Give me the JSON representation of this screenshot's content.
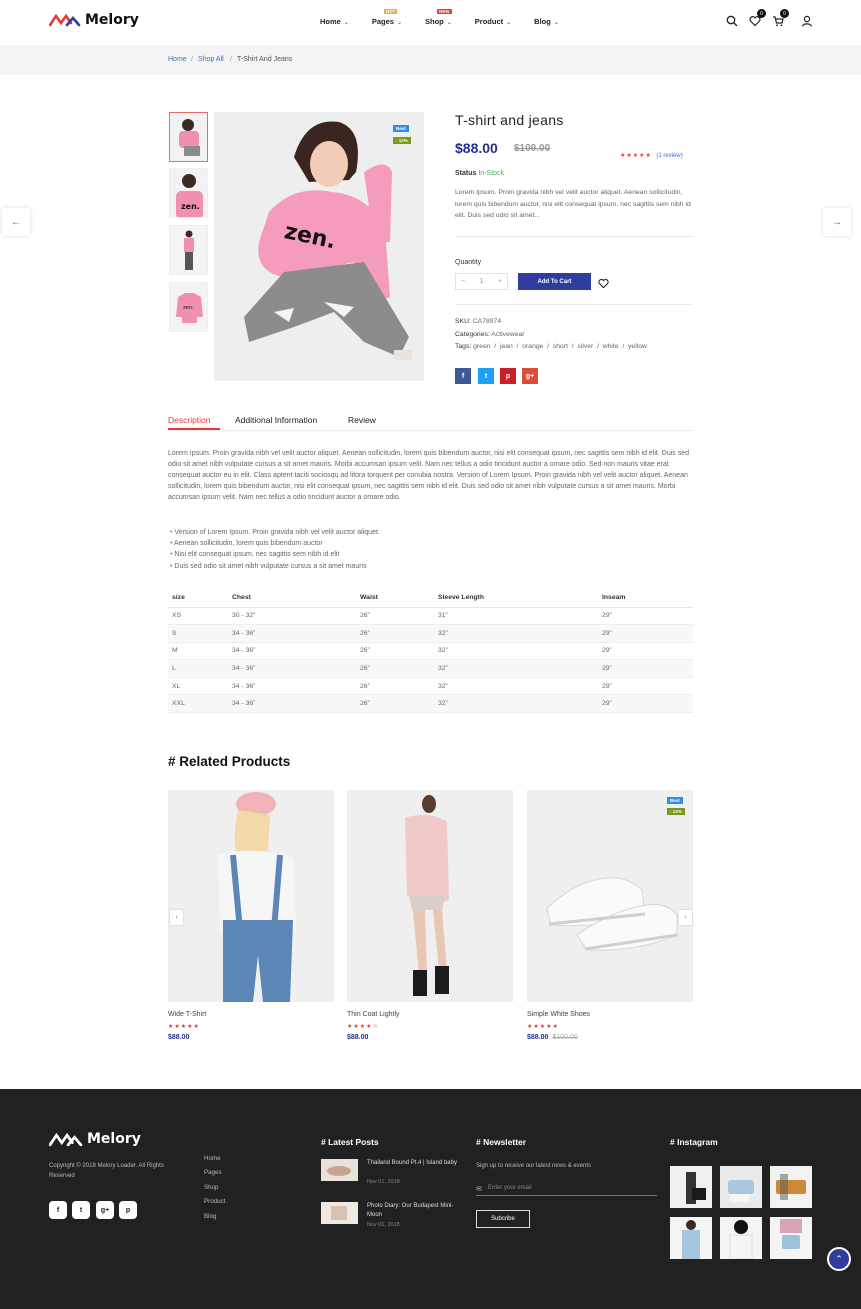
{
  "header": {
    "logo": "Melory",
    "nav": [
      {
        "label": "Home",
        "badge": ""
      },
      {
        "label": "Pages",
        "badge": "HOT",
        "badge_color": "#f0a34c"
      },
      {
        "label": "Shop",
        "badge": "NEW",
        "badge_color": "#e53935"
      },
      {
        "label": "Product",
        "badge": ""
      },
      {
        "label": "Blog",
        "badge": ""
      }
    ],
    "wishlist_count": "0",
    "cart_count": "0"
  },
  "breadcrumb": {
    "home": "Home",
    "shop": "Shop All",
    "sep": "/",
    "current": "T-Shirt And Jeans"
  },
  "product": {
    "title": "T-shirt and jeans",
    "price": "$88.00",
    "old_price": "$100.00",
    "stars": "★★★★★",
    "review_link": "(1 review)",
    "status_label": "Status",
    "status_value": "In-Stock",
    "excerpt": "Lorem Ipsum. Proin gravida nibh vel velit auctor aliquet. Aenean sollicitudin, lorem quis bibendum auctor, nisi elit consequat ipsum, nec sagittis sem nibh id elit. Duis sed odio sit amet...",
    "quantity_label": "Quantity",
    "quantity_value": "1",
    "qty_minus": "−",
    "qty_plus": "+",
    "add_to_cart": "Add To Cart",
    "badge_best": "Best",
    "badge_discount": "- 12%",
    "sku_label": "SKU:",
    "sku": "CA78974",
    "categories_label": "Categories:",
    "categories": "Activewear",
    "tags_label": "Tags:",
    "tags": "green  /  jean  /  orange  /  short  /  silver  /  white  /  yellow",
    "share": [
      "f",
      "t",
      "p",
      "g+"
    ],
    "share_colors": [
      "#3b5998",
      "#1da1f2",
      "#cb2027",
      "#dd4b39"
    ]
  },
  "tabs": {
    "description": "Description",
    "additional": "Additional Information",
    "review": "Review"
  },
  "description": {
    "paragraph": "Lorem Ipsum. Proin gravida nibh vel velit auctor aliquet. Aenean sollicitudin, lorem quis bibendum auctor, nisi elit consequat ipsum, nec sagittis sem nibh id elit. Duis sed odio sit amet nibh vulputate cursus a sit amet mauris. Morbi accumsan ipsum velit. Nam nec tellus a odio tincidunt auctor a ornare odio. Sed non mauris vitae erat consequat auctor eu in elit. Class aptent taciti sociosqu ad litora torquent per conubia nostra. Version of Lorem Ipsum. Proin gravida nibh vel velit auctor aliquet. Aenean sollicitudin, lorem quis bibendum auctor, nisi elit consequat ipsum, nec sagittis sem nibh id elit. Duis sed odio sit amet nibh vulputate cursus a sit amet mauris. Morbi accumsan ipsum velit. Nam nec tellus a odio tincidunt auctor a ornare odio.",
    "bullets": [
      "Version of Lorem Ipsum. Proin gravida nibh vel velit auctor aliquet.",
      "Aenean sollicitudin, lorem quis bibendum auctor",
      "Nisi elit consequat ipsum, nec sagittis sem nibh id elit",
      "Duis sed odio sit amet nibh vulputate cursus a sit amet mauris"
    ]
  },
  "size_table": {
    "headers": [
      "size",
      "Chest",
      "Waist",
      "Sleeve Length",
      "Inseam"
    ],
    "rows": [
      [
        "XS",
        "30 - 32”",
        "26”",
        "31”",
        "29”"
      ],
      [
        "S",
        "34 - 36”",
        "26”",
        "32”",
        "29”"
      ],
      [
        "M",
        "34 - 36”",
        "26”",
        "32”",
        "29”"
      ],
      [
        "L",
        "34 - 36”",
        "26”",
        "32”",
        "29”"
      ],
      [
        "XL",
        "34 - 36”",
        "26”",
        "32”",
        "29”"
      ],
      [
        "XXL",
        "34 - 36”",
        "26”",
        "32”",
        "29”"
      ]
    ]
  },
  "related": {
    "title": "# Related Products",
    "items": [
      {
        "name": "Wide T-Shirt",
        "stars": "★★★★★",
        "price": "$88.00",
        "old_price": ""
      },
      {
        "name": "Thin Coat Lightly",
        "stars": "★★★★☆",
        "price": "$88.00",
        "old_price": ""
      },
      {
        "name": "Simple White Shoes",
        "stars": "★★★★★",
        "price": "$88.00",
        "old_price": "$100.00",
        "badge_best": "Best",
        "badge_discount": "- 12%"
      }
    ]
  },
  "footer": {
    "logo": "Melory",
    "copyright": "Copyright © 2018 Melory Loader. All Rights Reserved",
    "social": [
      "f",
      "t",
      "g+",
      "p"
    ],
    "links": [
      "Home",
      "Pages",
      "Shop",
      "Product",
      "Blog"
    ],
    "latest_posts_title": "# Latest Posts",
    "posts": [
      {
        "title": "Thailand Bound Pt.4 | Island baby",
        "date": "Nov 01, 2018"
      },
      {
        "title": "Photo Diary: Our Budapest Mini-Moon",
        "date": "Nov 01, 2018"
      }
    ],
    "newsletter_title": "# Newsletter",
    "newsletter_text": "Sign up to receive our latest news & events",
    "email_placeholder": "Enter your email",
    "subscribe": "Subcribe",
    "instagram_title": "# Instagram"
  }
}
